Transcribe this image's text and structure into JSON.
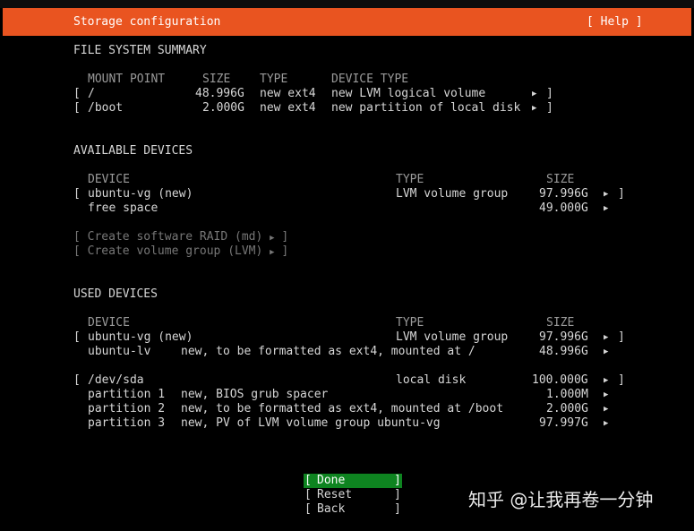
{
  "header": {
    "title": "Storage configuration",
    "help_label": "[ Help ]"
  },
  "fs_summary": {
    "title": "FILE SYSTEM SUMMARY",
    "columns": {
      "mount_point": "MOUNT POINT",
      "size": "SIZE",
      "type": "TYPE",
      "device_type": "DEVICE TYPE"
    },
    "rows": [
      {
        "mount": "/",
        "size": "48.996G",
        "type": "new ext4",
        "device_type": "new LVM logical volume"
      },
      {
        "mount": "/boot",
        "size": "2.000G",
        "type": "new ext4",
        "device_type": "new partition of local disk"
      }
    ]
  },
  "available": {
    "title": "AVAILABLE DEVICES",
    "columns": {
      "device": "DEVICE",
      "type": "TYPE",
      "size": "SIZE"
    },
    "vg": {
      "name": "ubuntu-vg (new)",
      "type": "LVM volume group",
      "size": "97.996G"
    },
    "free": {
      "name": "free space",
      "size": "49.000G"
    },
    "actions": {
      "raid": "Create software RAID (md)",
      "vg": "Create volume group (LVM)"
    }
  },
  "used": {
    "title": "USED DEVICES",
    "columns": {
      "device": "DEVICE",
      "type": "TYPE",
      "size": "SIZE"
    },
    "vg": {
      "name": "ubuntu-vg (new)",
      "type": "LVM volume group",
      "size": "97.996G"
    },
    "lv": {
      "name": "ubuntu-lv",
      "desc": "new, to be formatted as ext4, mounted at /",
      "size": "48.996G"
    },
    "disk": {
      "name": "/dev/sda",
      "type": "local disk",
      "size": "100.000G"
    },
    "partitions": [
      {
        "name": "partition 1",
        "desc": "new, BIOS grub spacer",
        "size": "1.000M"
      },
      {
        "name": "partition 2",
        "desc": "new, to be formatted as ext4, mounted at /boot",
        "size": "2.000G"
      },
      {
        "name": "partition 3",
        "desc": "new, PV of LVM volume group ubuntu-vg",
        "size": "97.997G"
      }
    ]
  },
  "buttons": {
    "done": "Done",
    "reset": "Reset",
    "back": "Back"
  },
  "watermark": "知乎 @让我再卷一分钟",
  "colors": {
    "header_bg": "#e95420",
    "focus_bg": "#0e8420",
    "background": "#000000"
  }
}
